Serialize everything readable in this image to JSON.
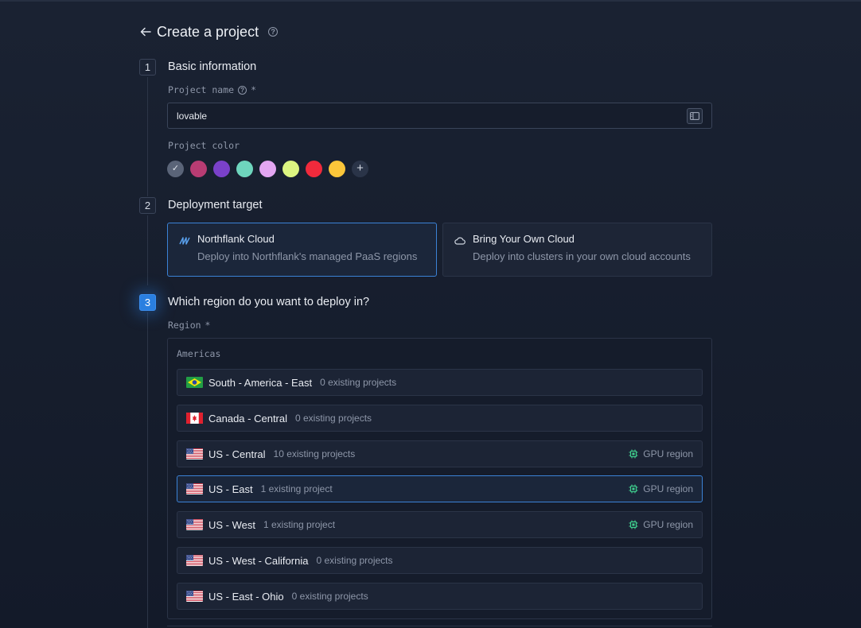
{
  "header": {
    "title": "Create a project"
  },
  "steps": [
    {
      "num": "1",
      "title": "Basic information"
    },
    {
      "num": "2",
      "title": "Deployment target"
    },
    {
      "num": "3",
      "title": "Which region do you want to deploy in?"
    }
  ],
  "basic": {
    "name_label": "Project name",
    "required_mark": "*",
    "name_value": "lovable",
    "color_label": "Project color",
    "colors": [
      "#5a6478",
      "#b83c73",
      "#7a41c9",
      "#6ed5bd",
      "#e3a6f2",
      "#dcf581",
      "#f02a3c",
      "#fbc63a"
    ],
    "selected_color": "#5a6478",
    "add_color_label": "+"
  },
  "targets": [
    {
      "title": "Northflank Cloud",
      "desc": "Deploy into Northflank's managed PaaS regions",
      "selected": true
    },
    {
      "title": "Bring Your Own Cloud",
      "desc": "Deploy into clusters in your own cloud accounts",
      "selected": false
    }
  ],
  "region": {
    "label": "Region",
    "required_mark": "*",
    "group": "Americas",
    "gpu_label": "GPU region",
    "rows": [
      {
        "flag": "br",
        "name": "South - America - East",
        "count": "0 existing projects",
        "gpu": false
      },
      {
        "flag": "ca",
        "name": "Canada - Central",
        "count": "0 existing projects",
        "gpu": false
      },
      {
        "flag": "us",
        "name": "US - Central",
        "count": "10 existing projects",
        "gpu": true
      },
      {
        "flag": "us",
        "name": "US - East",
        "count": "1 existing project",
        "gpu": true,
        "selected": true
      },
      {
        "flag": "us",
        "name": "US - West",
        "count": "1 existing project",
        "gpu": true
      },
      {
        "flag": "us",
        "name": "US - West - California",
        "count": "0 existing projects",
        "gpu": false
      },
      {
        "flag": "us",
        "name": "US - East - Ohio",
        "count": "0 existing projects",
        "gpu": false
      }
    ]
  },
  "colors": {
    "accent": "#2a7fe0",
    "gpu_green": "#3fcf8e"
  }
}
